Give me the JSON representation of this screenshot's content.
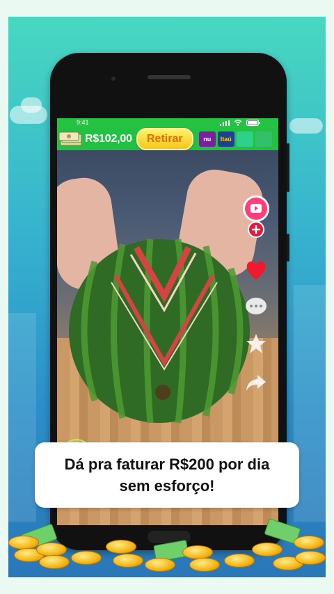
{
  "status": {
    "time": "9:41"
  },
  "topbar": {
    "balance": "R$102,00",
    "withdraw_label": "Retirar",
    "banks": [
      "nu",
      "Itaú"
    ]
  },
  "side": {
    "video_icon": "play-badge-icon",
    "add_icon": "plus-icon",
    "like_icon": "heart-icon",
    "comment_icon": "comment-dots-icon",
    "favorite_icon": "star-icon",
    "share_icon": "share-arrow-icon"
  },
  "caption": {
    "line1": "Dá pra faturar R$200 por dia",
    "line2": "sem esforço!"
  },
  "colors": {
    "bar_green": "#23c143",
    "withdraw_yellow": "#f6c61a",
    "nubank_purple": "#7b1fa2",
    "itau_blue": "#1d3f94"
  }
}
